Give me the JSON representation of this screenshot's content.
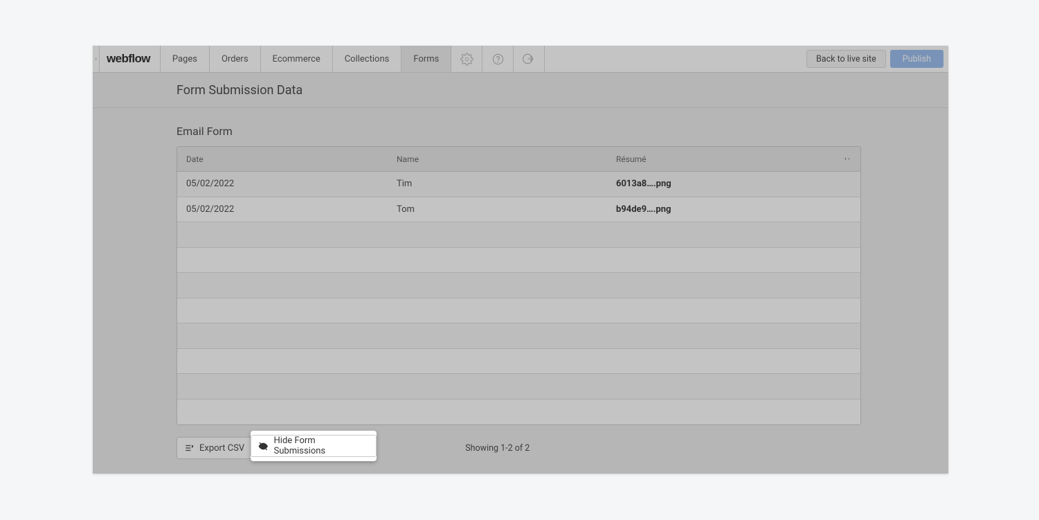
{
  "nav": {
    "logo": "webflow",
    "items": [
      "Pages",
      "Orders",
      "Ecommerce",
      "Collections",
      "Forms"
    ],
    "active_index": 4,
    "back_to_live": "Back to live site",
    "publish": "Publish"
  },
  "page": {
    "title": "Form Submission Data",
    "form_name": "Email Form"
  },
  "table": {
    "headers": {
      "date": "Date",
      "name": "Name",
      "resume": "Résumé"
    },
    "rows": [
      {
        "date": "05/02/2022",
        "name": "Tim",
        "resume": "6013a8….png"
      },
      {
        "date": "05/02/2022",
        "name": "Tom",
        "resume": "b94de9….png"
      }
    ],
    "empty_rows_count": 8
  },
  "footer": {
    "export_csv": "Export CSV",
    "hide_submissions": "Hide Form Submissions",
    "showing": "Showing 1-2 of 2"
  }
}
